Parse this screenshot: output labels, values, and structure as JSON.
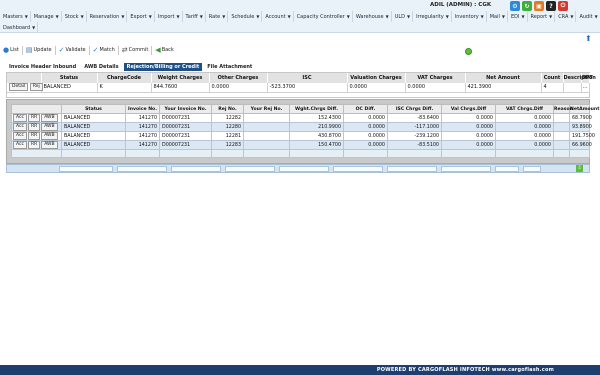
{
  "header": {
    "user": "ADIL (ADMIN) : CGK",
    "menu_row1": [
      "Masters",
      "Manage",
      "Stock",
      "Reservation",
      "Export",
      "Import",
      "Tariff",
      "Rate",
      "Schedule",
      "Account",
      "Capacity Controller",
      "Warehouse",
      "ULD",
      "Irregularity",
      "Inventory",
      "Mail",
      "EDI",
      "Report",
      "CRA",
      "Audit"
    ],
    "menu_row2": [
      "Dashboard"
    ]
  },
  "toolbar": {
    "list": "List",
    "update": "Update",
    "validate": "Validate",
    "match": "Match",
    "commit": "Commit",
    "back": "Back"
  },
  "tabs": [
    "Invoice Header Inbound",
    "AWB Details",
    "Rejection/Billing or Credit",
    "File Attachment"
  ],
  "header_table": {
    "columns": [
      "",
      "Status",
      "ChargeCode",
      "Weight Charges",
      "Other Charges",
      "ISC",
      "Valuation Charges",
      "VAT Charges",
      "Net Amount",
      "Count",
      "Description",
      "OPT"
    ],
    "row": {
      "btn_detail": "Detail",
      "btn_rej": "Rej",
      "status": "BALANCED",
      "charge_code": "K",
      "weight_charges": "844.7600",
      "other_charges": "0.0000",
      "isc": "-523.3700",
      "valuation_charges": "0.0000",
      "vat_charges": "0.0000",
      "net_amount": "421.3900",
      "count": "4",
      "description": "",
      "opt": "..."
    }
  },
  "detail_table": {
    "columns": [
      "",
      "Status",
      "Invoice No.",
      "Your Invoice No.",
      "Rej No.",
      "Your Rej No.",
      "Wght.Chrgs Diff.",
      "OC Diff.",
      "ISC Chrgs Diff.",
      "Val Chrgs.Diff",
      "VAT Chrgs.Diff",
      "Reason",
      "NetAmount"
    ],
    "buttons": [
      "Acc",
      "RR",
      "AWB"
    ],
    "rows": [
      {
        "status": "BALANCED",
        "invoice_no": "141270",
        "your_invoice_no": "D00007231",
        "rej_no": "12282",
        "your_rej_no": "",
        "wght_diff": "152.4300",
        "oc_diff": "0.0000",
        "isc_diff": "-83.6400",
        "val_diff": "0.0000",
        "vat_diff": "0.0000",
        "reason": "",
        "net_amount": "68.7900"
      },
      {
        "status": "BALANCED",
        "invoice_no": "141270",
        "your_invoice_no": "D00007231",
        "rej_no": "12280",
        "your_rej_no": "",
        "wght_diff": "210.9900",
        "oc_diff": "0.0000",
        "isc_diff": "-117.1000",
        "val_diff": "0.0000",
        "vat_diff": "0.0000",
        "reason": "",
        "net_amount": "93.8900"
      },
      {
        "status": "BALANCED",
        "invoice_no": "141270",
        "your_invoice_no": "D00007231",
        "rej_no": "12281",
        "your_rej_no": "",
        "wght_diff": "430.8700",
        "oc_diff": "0.0000",
        "isc_diff": "-239.1200",
        "val_diff": "0.0000",
        "vat_diff": "0.0000",
        "reason": "",
        "net_amount": "191.7500"
      },
      {
        "status": "BALANCED",
        "invoice_no": "141270",
        "your_invoice_no": "D00007231",
        "rej_no": "12283",
        "your_rej_no": "",
        "wght_diff": "150.4700",
        "oc_diff": "0.0000",
        "isc_diff": "-83.5100",
        "val_diff": "0.0000",
        "vat_diff": "0.0000",
        "reason": "",
        "net_amount": "66.9600"
      }
    ]
  },
  "footer": {
    "text": "POWERED BY CARGOFLASH INFOTECH www.cargoflash.com"
  },
  "colors": {
    "menu_bg": "#e9f1f9",
    "active_tab": "#1e4f86",
    "footer_bg": "#1e3f6e",
    "row_alt": "#dbe8f4"
  }
}
